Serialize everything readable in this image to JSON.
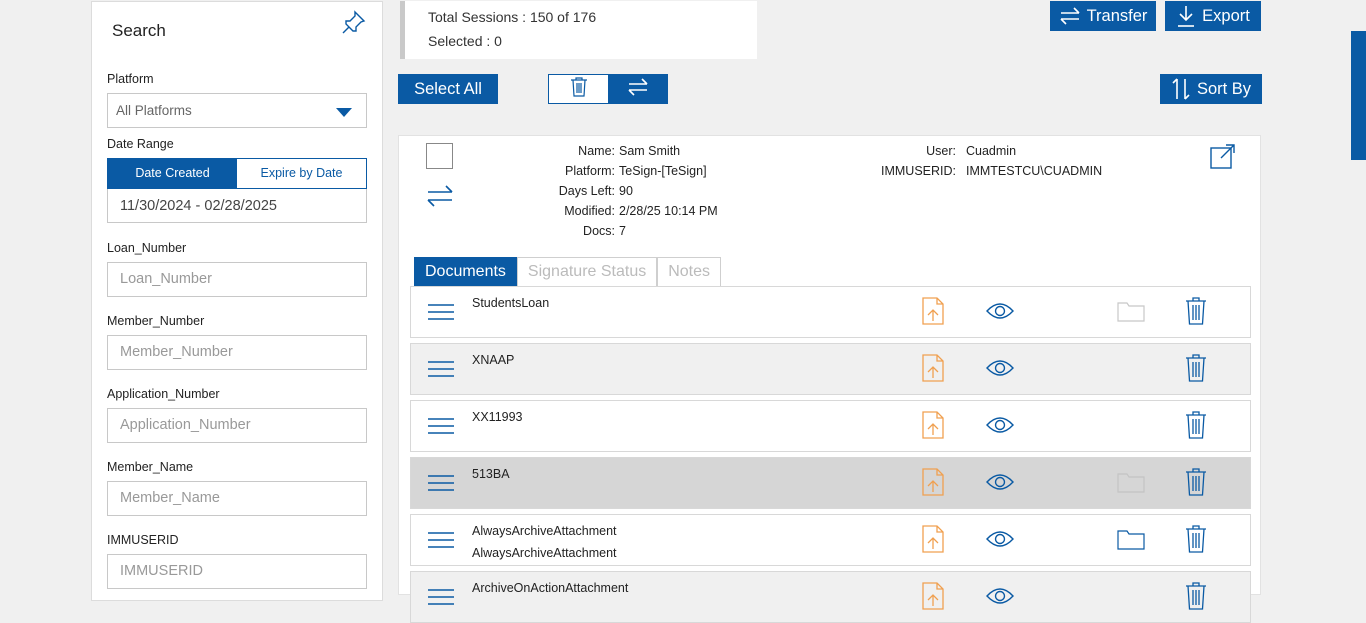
{
  "sidebar": {
    "title": "Search",
    "platform_label": "Platform",
    "platform_value": "All Platforms",
    "date_range_label": "Date Range",
    "date_created": "Date Created",
    "expire_by_date": "Expire by Date",
    "date_range_value": "11/30/2024 - 02/28/2025",
    "loan_number_label": "Loan_Number",
    "loan_number_placeholder": "Loan_Number",
    "member_number_label": "Member_Number",
    "member_number_placeholder": "Member_Number",
    "application_number_label": "Application_Number",
    "application_number_placeholder": "Application_Number",
    "member_name_label": "Member_Name",
    "member_name_placeholder": "Member_Name",
    "immuserid_label": "IMMUSERID",
    "immuserid_placeholder": "IMMUSERID"
  },
  "summary": {
    "total_sessions": "Total Sessions : 150 of 176",
    "selected": "Selected : 0"
  },
  "toolbar": {
    "transfer": "Transfer",
    "export": "Export",
    "select_all": "Select All",
    "sort_by": "Sort By"
  },
  "session": {
    "name_key": "Name:",
    "name": "Sam Smith",
    "platform_key": "Platform:",
    "platform": "TeSign-[TeSign]",
    "days_left_key": "Days Left:",
    "days_left": "90",
    "modified_key": "Modified:",
    "modified": "2/28/25 10:14 PM",
    "docs_key": "Docs:",
    "docs": "7",
    "user_key": "User:",
    "user": "Cuadmin",
    "immuserid_key": "IMMUSERID:",
    "immuserid": "IMMTESTCU\\CUADMIN"
  },
  "tabs": [
    "Documents",
    "Signature Status",
    "Notes"
  ],
  "documents": [
    {
      "name": "StudentsLoan",
      "name2": "",
      "folder": "light"
    },
    {
      "name": "XNAAP",
      "name2": "",
      "folder": "none"
    },
    {
      "name": "XX11993",
      "name2": "",
      "folder": "none"
    },
    {
      "name": "513BA",
      "name2": "",
      "folder": "faint"
    },
    {
      "name": "AlwaysArchiveAttachment",
      "name2": "AlwaysArchiveAttachment",
      "folder": "blue"
    },
    {
      "name": "ArchiveOnActionAttachment",
      "name2": "",
      "folder": "none"
    }
  ],
  "colors": {
    "primary": "#0a5aa4",
    "upload_orange": "#f0a050",
    "row_alt": "#f0f0f0",
    "row_selected": "#d6d6d6"
  }
}
